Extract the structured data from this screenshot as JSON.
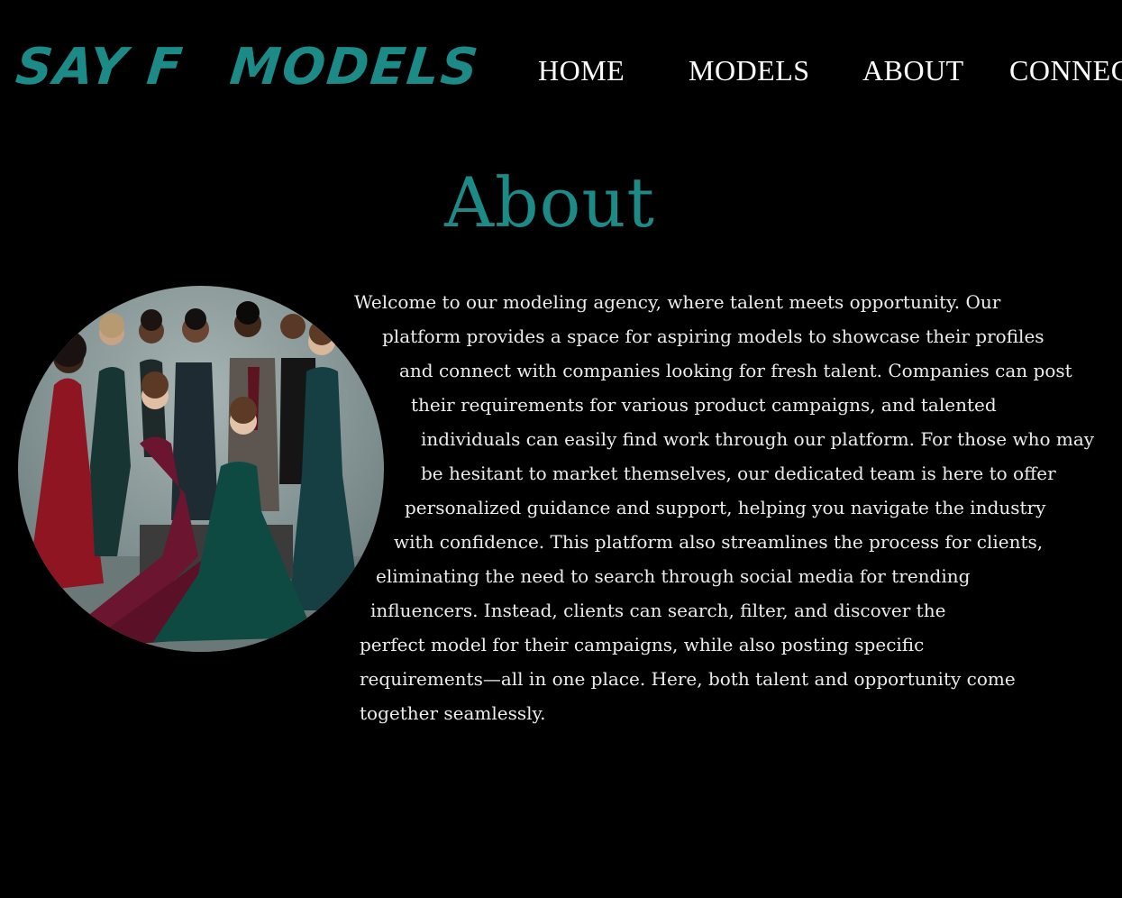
{
  "brand": {
    "part1": "SAY F",
    "part2": "MODELS",
    "color": "#1c8a86"
  },
  "nav": {
    "home": "HOME",
    "models": "MODELS",
    "about": "ABOUT",
    "connect": "CONNEC"
  },
  "about": {
    "title": "About",
    "image_alt": "Group of models in formal evening wear",
    "lines": [
      "Welcome to our modeling agency, where talent meets opportunity. Our",
      "platform provides a space for aspiring models to showcase their profiles",
      "and connect with companies looking for fresh talent. Companies can post",
      "their requirements for various product campaigns, and talented",
      "individuals can easily find work through our platform. For those who may",
      "be hesitant to market themselves, our dedicated team is here to offer",
      "personalized guidance and support, helping you navigate the industry",
      "with confidence. This platform also streamlines the process for clients,",
      "eliminating the need to search through social media for trending",
      "influencers. Instead, clients can search, filter, and discover the",
      "perfect model for their campaigns, while also posting specific",
      "requirements—all in one place. Here, both talent and opportunity come",
      "together seamlessly."
    ]
  },
  "colors": {
    "background": "#000000",
    "accent": "#1c8a86",
    "text": "#ececec"
  }
}
